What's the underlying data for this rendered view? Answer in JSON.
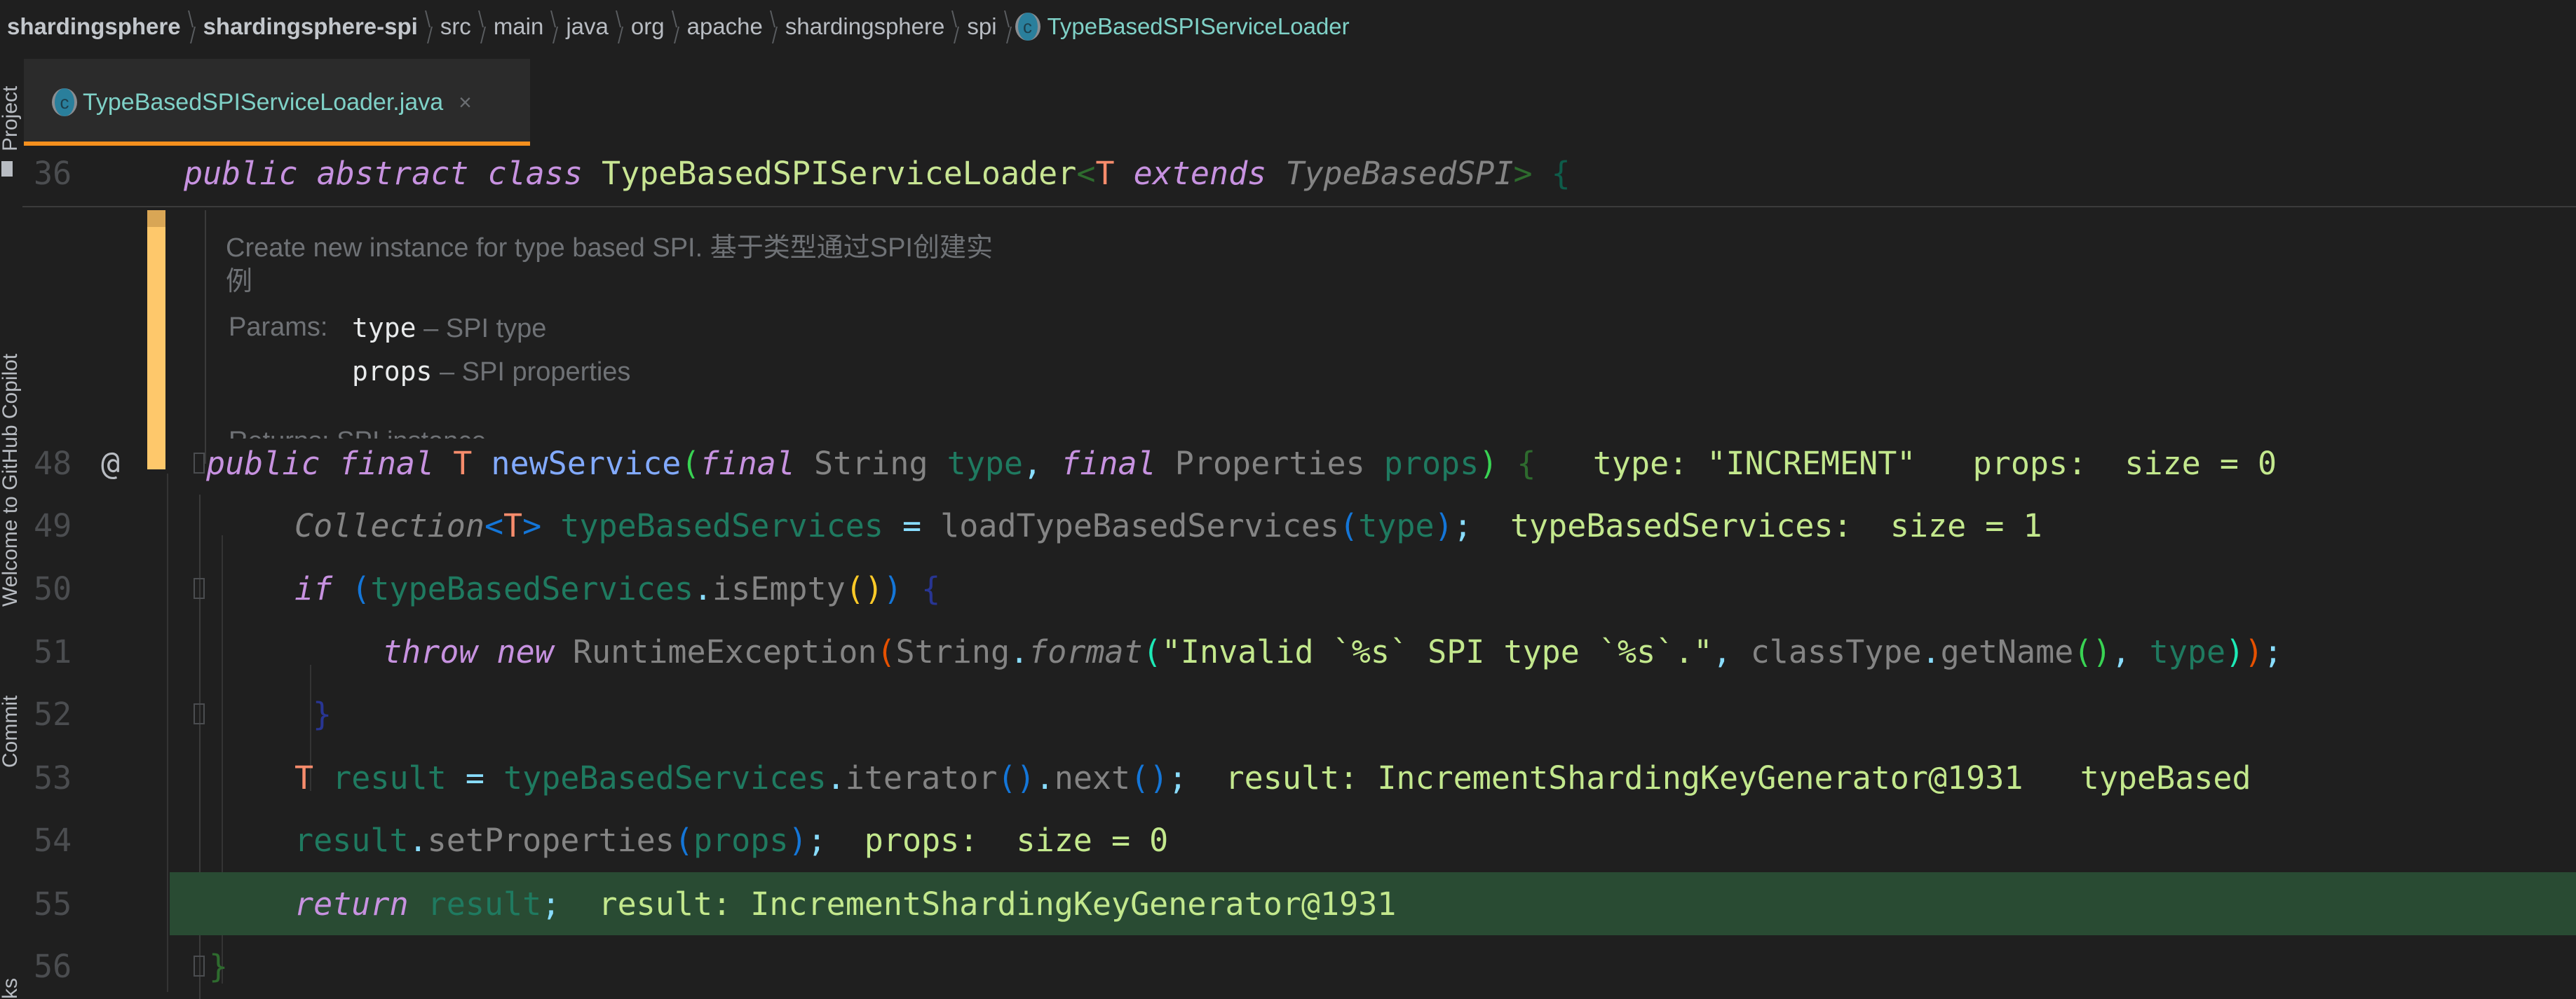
{
  "breadcrumb": {
    "items": [
      "shardingsphere",
      "shardingsphere-spi",
      "src",
      "main",
      "java",
      "org",
      "apache",
      "shardingsphere",
      "spi"
    ],
    "current_class": "TypeBasedSPIServiceLoader",
    "class_icon_glyph": "c"
  },
  "sidebar": {
    "tools": [
      "Project",
      "Welcome to GitHub Copilot",
      "Commit",
      "ks"
    ]
  },
  "tabs": [
    {
      "label": "TypeBasedSPIServiceLoader.java",
      "icon": "class-icon",
      "close": "×",
      "active": true
    }
  ],
  "editor": {
    "line36": {
      "number": "36",
      "tokens": [
        "public abstract class ",
        "TypeBasedSPIServiceLoader",
        "<",
        "T",
        " extends ",
        "TypeBasedSPI",
        ">",
        " {"
      ]
    },
    "javadoc": {
      "description": "Create new instance for type based SPI. 基于类型通过SPI创建实",
      "description_wrap": "例",
      "params_label": "Params:",
      "params": [
        {
          "name": "type",
          "desc": "– SPI type"
        },
        {
          "name": "props",
          "desc": "– SPI properties"
        }
      ],
      "returns_partial": "Returns: SPI instance"
    },
    "lines": [
      {
        "number": "48",
        "annotation": "@"
      },
      {
        "number": "49"
      },
      {
        "number": "50"
      },
      {
        "number": "51"
      },
      {
        "number": "52"
      },
      {
        "number": "53"
      },
      {
        "number": "54"
      },
      {
        "number": "55",
        "highlighted": true
      },
      {
        "number": "56"
      }
    ],
    "code": {
      "l48": [
        "public final ",
        "T",
        " ",
        "newService",
        "(",
        "final ",
        "String ",
        "type",
        ", ",
        "final ",
        "Properties ",
        "props",
        ")",
        " {"
      ],
      "l48_hint": "type: \"INCREMENT\"   props:  size = 0",
      "l49": [
        "Collection",
        "<",
        "T",
        ">",
        " typeBasedServices",
        " = ",
        "loadTypeBasedServices",
        "(",
        "type",
        ")",
        ";"
      ],
      "l49_hint": "typeBasedServices:  size = 1",
      "l50": [
        "if ",
        "(",
        "typeBasedServices",
        ".",
        "isEmpty",
        "(",
        ")",
        ")",
        " {"
      ],
      "l51": [
        "throw new ",
        "RuntimeException",
        "(",
        "String",
        ".",
        "format",
        "(",
        "\"Invalid `%s` SPI type `%s`.\"",
        ", ",
        "classType",
        ".",
        "getName",
        "(",
        ")",
        ", ",
        "type",
        ")",
        ")",
        ";"
      ],
      "l52": [
        "}"
      ],
      "l53": [
        "T",
        " result",
        " = ",
        "typeBasedServices",
        ".",
        "iterator",
        "(",
        ")",
        ".",
        "next",
        "(",
        ")",
        ";"
      ],
      "l53_hint": "result: IncrementShardingKeyGenerator@1931   typeBased",
      "l54": [
        "result",
        ".",
        "setProperties",
        "(",
        "props",
        ")",
        ";"
      ],
      "l54_hint": "props:  size = 0",
      "l55": [
        "return ",
        "result",
        ";"
      ],
      "l55_hint": "result: IncrementShardingKeyGenerator@1931",
      "l56": [
        "}"
      ]
    }
  },
  "colors": {
    "accent_tab_underline": "#f5901e",
    "execution_line": "#294b33",
    "javadoc_marker": "#fec86b"
  }
}
